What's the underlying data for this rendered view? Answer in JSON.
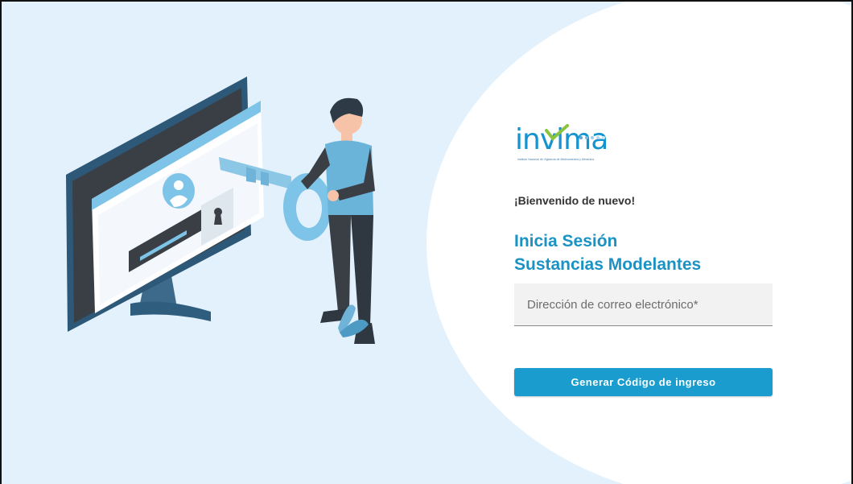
{
  "logo": {
    "text": "invima",
    "tagline": "Instituto Nacional de Vigilancia de Medicamentos y Alimentos."
  },
  "login": {
    "welcome": "¡Bienvenido de nuevo!",
    "title_line1": "Inicia Sesión",
    "title_line2": "Sustancias Modelantes",
    "email_placeholder": "Dirección de correo electrónico*",
    "email_value": "",
    "submit_label": "Generar Código de ingreso"
  },
  "illustration": {
    "icon": "person-holding-key-at-monitor-illustration"
  },
  "colors": {
    "accent": "#1a9dce",
    "title": "#1a93c4",
    "background": "#e3f1fc",
    "logo_green": "#8ac43f"
  }
}
